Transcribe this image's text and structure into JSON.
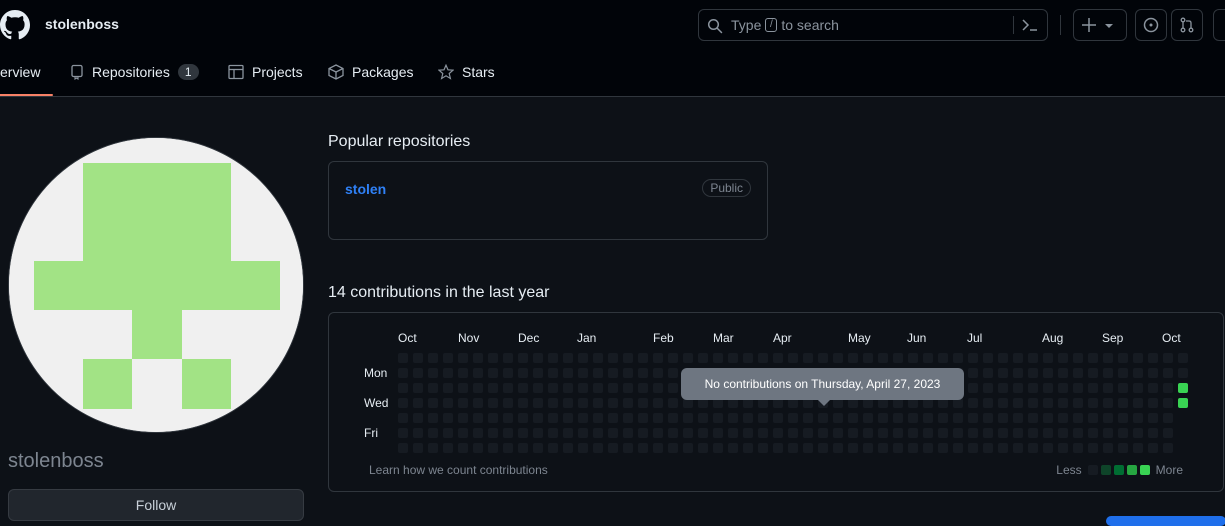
{
  "header": {
    "username": "stolenboss",
    "search": {
      "prefix": "Type",
      "key": "/",
      "suffix": "to search"
    }
  },
  "nav": {
    "tabs": [
      {
        "label": "Overview",
        "visible_label": "erview",
        "active": true
      },
      {
        "label": "Repositories",
        "count": "1"
      },
      {
        "label": "Projects"
      },
      {
        "label": "Packages"
      },
      {
        "label": "Stars"
      }
    ]
  },
  "profile": {
    "name": "stolenboss",
    "follow_label": "Follow"
  },
  "popular": {
    "title": "Popular repositories",
    "repos": [
      {
        "name": "stolen",
        "visibility": "Public"
      }
    ]
  },
  "contributions": {
    "title": "14 contributions in the last year",
    "months": [
      "Oct",
      "Nov",
      "Dec",
      "Jan",
      "Feb",
      "Mar",
      "Apr",
      "May",
      "Jun",
      "Jul",
      "Aug",
      "Sep",
      "Oct"
    ],
    "days": [
      "Mon",
      "Wed",
      "Fri"
    ],
    "footer_link": "Learn how we count contributions",
    "legend_less": "Less",
    "legend_more": "More",
    "tooltip": "No contributions on Thursday, April 27, 2023",
    "colors": {
      "empty": "#161b22",
      "l1": "#0e4429",
      "l2": "#006d32",
      "l3": "#26a641",
      "l4": "#39d353"
    },
    "active_days": [
      {
        "week": 52,
        "weekday": 2,
        "level": 4
      },
      {
        "week": 52,
        "weekday": 3,
        "level": 4
      }
    ]
  },
  "colors": {
    "accent": "#f78166",
    "link": "#2f81f7",
    "avatar_green": "#a2e385"
  }
}
